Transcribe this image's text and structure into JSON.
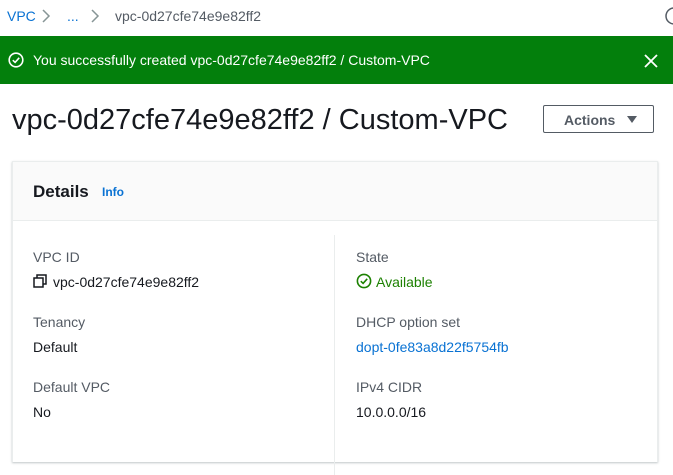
{
  "breadcrumb": {
    "root": "VPC",
    "ellipsis": "...",
    "current": "vpc-0d27cfe74e9e82ff2"
  },
  "flash": {
    "status": "success",
    "message": "You successfully created vpc-0d27cfe74e9e82ff2 / Custom-VPC"
  },
  "page": {
    "title": "vpc-0d27cfe74e9e82ff2 / Custom-VPC",
    "actions_label": "Actions"
  },
  "details": {
    "title": "Details",
    "info_label": "Info",
    "fields": {
      "vpc_id": {
        "label": "VPC ID",
        "value": "vpc-0d27cfe74e9e82ff2"
      },
      "state": {
        "label": "State",
        "value": "Available"
      },
      "tenancy": {
        "label": "Tenancy",
        "value": "Default"
      },
      "dhcp": {
        "label": "DHCP option set",
        "value": "dopt-0fe83a8d22f5754fb"
      },
      "default_vpc": {
        "label": "Default VPC",
        "value": "No"
      },
      "ipv4_cidr": {
        "label": "IPv4 CIDR",
        "value": "10.0.0.0/16"
      }
    }
  },
  "icons": {
    "breadcrumb_separator": "chevron-right-icon",
    "help": "help-circle-icon",
    "success": "check-circle-icon",
    "close": "close-icon",
    "dropdown": "caret-down-icon",
    "copy": "copy-icon",
    "status_ok": "status-available-icon"
  },
  "colors": {
    "success_banner": "#037f0c",
    "link": "#0972d3",
    "status_available": "#1d8102",
    "secondary_text": "#545b64"
  }
}
